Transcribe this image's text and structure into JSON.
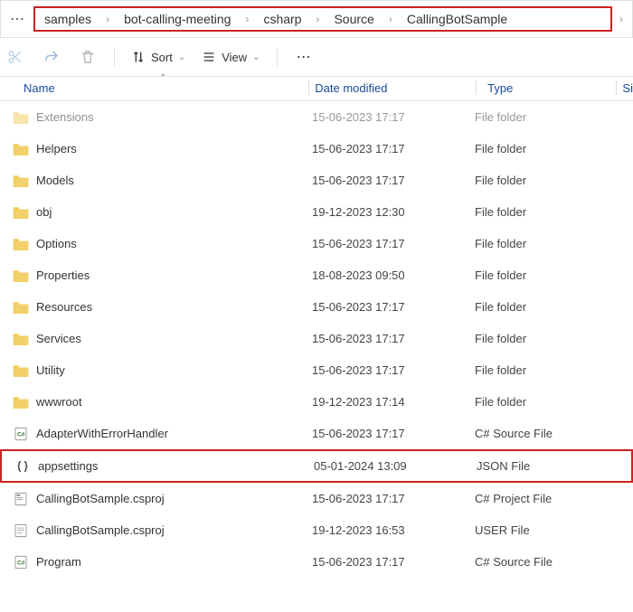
{
  "breadcrumb": {
    "items": [
      "samples",
      "bot-calling-meeting",
      "csharp",
      "Source",
      "CallingBotSample"
    ]
  },
  "toolbar": {
    "sort_label": "Sort",
    "view_label": "View"
  },
  "columns": {
    "name": "Name",
    "date": "Date modified",
    "type": "Type",
    "size": "Si"
  },
  "files": [
    {
      "icon": "folder",
      "name": "Extensions",
      "date": "15-06-2023 17:17",
      "type": "File folder",
      "faded": true
    },
    {
      "icon": "folder",
      "name": "Helpers",
      "date": "15-06-2023 17:17",
      "type": "File folder"
    },
    {
      "icon": "folder",
      "name": "Models",
      "date": "15-06-2023 17:17",
      "type": "File folder"
    },
    {
      "icon": "folder",
      "name": "obj",
      "date": "19-12-2023 12:30",
      "type": "File folder"
    },
    {
      "icon": "folder",
      "name": "Options",
      "date": "15-06-2023 17:17",
      "type": "File folder"
    },
    {
      "icon": "folder",
      "name": "Properties",
      "date": "18-08-2023 09:50",
      "type": "File folder"
    },
    {
      "icon": "folder",
      "name": "Resources",
      "date": "15-06-2023 17:17",
      "type": "File folder"
    },
    {
      "icon": "folder",
      "name": "Services",
      "date": "15-06-2023 17:17",
      "type": "File folder"
    },
    {
      "icon": "folder",
      "name": "Utility",
      "date": "15-06-2023 17:17",
      "type": "File folder"
    },
    {
      "icon": "folder",
      "name": "wwwroot",
      "date": "19-12-2023 17:14",
      "type": "File folder"
    },
    {
      "icon": "cs",
      "name": "AdapterWithErrorHandler",
      "date": "15-06-2023 17:17",
      "type": "C# Source File"
    },
    {
      "icon": "json",
      "name": "appsettings",
      "date": "05-01-2024 13:09",
      "type": "JSON File",
      "highlight": true
    },
    {
      "icon": "csproj",
      "name": "CallingBotSample.csproj",
      "date": "15-06-2023 17:17",
      "type": "C# Project File"
    },
    {
      "icon": "user",
      "name": "CallingBotSample.csproj",
      "date": "19-12-2023 16:53",
      "type": "USER File"
    },
    {
      "icon": "cs",
      "name": "Program",
      "date": "15-06-2023 17:17",
      "type": "C# Source File"
    }
  ]
}
